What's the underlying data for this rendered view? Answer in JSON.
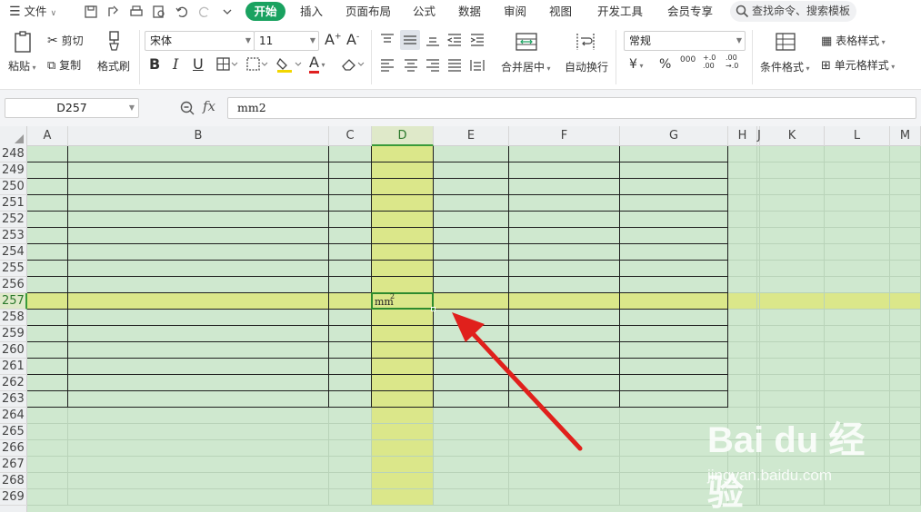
{
  "menubar": {
    "menu_label": "文件",
    "tabs": [
      "开始",
      "插入",
      "页面布局",
      "公式",
      "数据",
      "审阅",
      "视图",
      "开发工具",
      "会员专享"
    ],
    "search_placeholder": "查找命令、搜索模板"
  },
  "ribbon": {
    "paste": "粘贴",
    "cut": "剪切",
    "copy": "复制",
    "format_painter": "格式刷",
    "font_name": "宋体",
    "font_size": "11",
    "bold": "B",
    "italic": "I",
    "underline": "U",
    "merge_center": "合并居中",
    "wrap_text": "自动换行",
    "number_format": "常规",
    "currency": "¥",
    "percent": "%",
    "thousands": "000",
    "inc_decimal": "+.0\n.00",
    "dec_decimal": ".00\n→.0",
    "conditional_format": "条件格式",
    "table_style": "表格样式",
    "cell_style": "单元格样式",
    "font_color": "A"
  },
  "formula_bar": {
    "name_box": "D257",
    "fx": "fx",
    "content": "mm2"
  },
  "sheet": {
    "columns": [
      "A",
      "B",
      "C",
      "D",
      "E",
      "F",
      "G",
      "H",
      "J",
      "K",
      "L",
      "M"
    ],
    "rows": [
      "248",
      "249",
      "250",
      "251",
      "252",
      "253",
      "254",
      "255",
      "256",
      "257",
      "258",
      "259",
      "260",
      "261",
      "262",
      "263",
      "264",
      "265",
      "266",
      "267",
      "268",
      "269"
    ],
    "selected_cell": "D257",
    "cell_value": "mm",
    "cell_superscript": "2"
  },
  "watermark": {
    "brand": "Bai du 经验",
    "url": "jingyan.baidu.com"
  },
  "colors": {
    "accent": "#1aa260",
    "selection": "#2e8b2e",
    "sheet_bg": "#cfe8cf",
    "highlight": "#dbe78a",
    "arrow": "#e0201c"
  }
}
